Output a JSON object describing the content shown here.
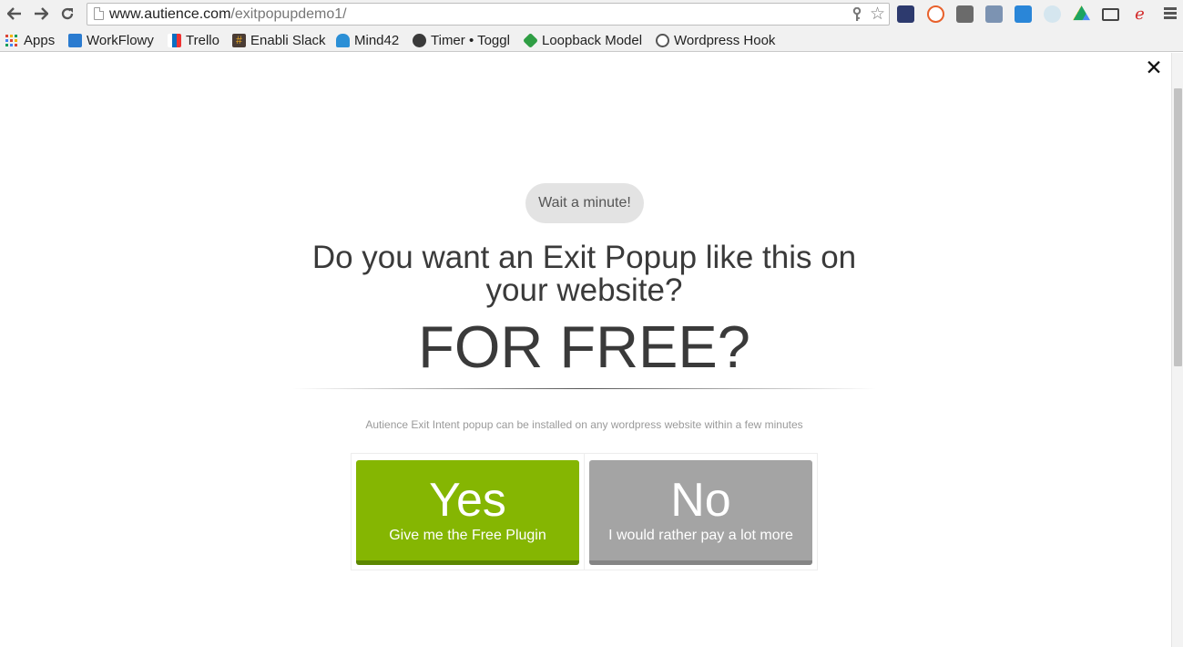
{
  "browser": {
    "url_host": "www.autience.com",
    "url_path": "/exitpopupdemo1/",
    "extensions": [
      "puzzle-ext-icon",
      "b-ext-icon",
      "camera-ext-icon",
      "screen-ext-icon",
      "arrow-ext-icon",
      "eye-ext-icon",
      "drive-icon",
      "cast-icon",
      "e-ext-icon"
    ]
  },
  "bookmarks": [
    {
      "label": "Apps",
      "icon": "apps-grid-icon"
    },
    {
      "label": "WorkFlowy",
      "icon": "workflowy-icon"
    },
    {
      "label": "Trello",
      "icon": "trello-icon"
    },
    {
      "label": "Enabli Slack",
      "icon": "slack-icon"
    },
    {
      "label": "Mind42",
      "icon": "mind42-icon"
    },
    {
      "label": "Timer • Toggl",
      "icon": "toggl-icon"
    },
    {
      "label": "Loopback Model",
      "icon": "loopback-icon"
    },
    {
      "label": "Wordpress Hook",
      "icon": "wordpress-icon"
    }
  ],
  "popup": {
    "close_symbol": "✕",
    "pill": "Wait a minute!",
    "headline": "Do you want an Exit Popup like this on your website?",
    "big_text": "FOR FREE?",
    "subtext": "Autience Exit Intent popup can be installed on any wordpress website within a few minutes",
    "yes": {
      "title": "Yes",
      "subtitle": "Give me the Free Plugin"
    },
    "no": {
      "title": "No",
      "subtitle": "I would rather pay a lot more"
    }
  },
  "colors": {
    "yes": "#85b602",
    "no": "#a4a4a4",
    "pill": "#e3e3e3",
    "text": "#3a3a3a"
  }
}
